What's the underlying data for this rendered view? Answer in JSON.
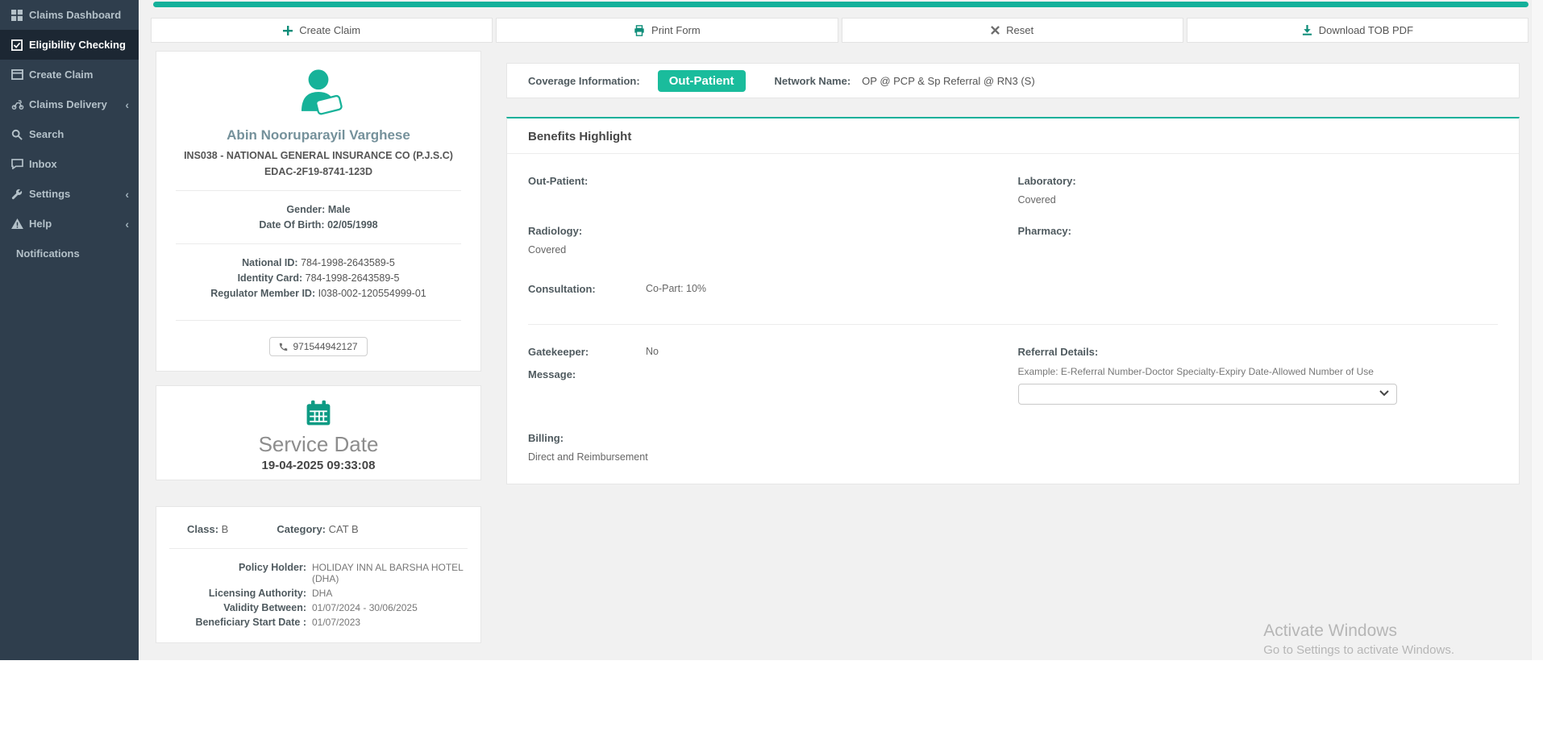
{
  "colors": {
    "accent_teal": "#14b09a",
    "badge_teal": "#1abc9c",
    "sidebar_bg": "#2f3e4d",
    "sidebar_active_bg": "#1c2733",
    "page_bg": "#f1f1f1"
  },
  "sidebar": {
    "items": [
      {
        "label": "Claims Dashboard",
        "icon": "grid-icon",
        "active": false,
        "chevron": false
      },
      {
        "label": "Eligibility Checking",
        "icon": "check-square-icon",
        "active": true,
        "chevron": false
      },
      {
        "label": "Create Claim",
        "icon": "card-icon",
        "active": false,
        "chevron": false
      },
      {
        "label": "Claims Delivery",
        "icon": "scooter-icon",
        "active": false,
        "chevron": true
      },
      {
        "label": "Search",
        "icon": "search-icon",
        "active": false,
        "chevron": false
      },
      {
        "label": "Inbox",
        "icon": "chat-icon",
        "active": false,
        "chevron": false
      },
      {
        "label": "Settings",
        "icon": "wrench-icon",
        "active": false,
        "chevron": true
      },
      {
        "label": "Help",
        "icon": "warning-icon",
        "active": false,
        "chevron": true
      },
      {
        "label": "Notifications",
        "icon": "",
        "active": false,
        "chevron": false
      }
    ],
    "chevron_glyph": "‹"
  },
  "toolbar": {
    "buttons": [
      {
        "label": "Create Claim",
        "icon": "plus-icon"
      },
      {
        "label": "Print Form",
        "icon": "printer-icon"
      },
      {
        "label": "Reset",
        "icon": "x-icon"
      },
      {
        "label": "Download TOB PDF",
        "icon": "download-icon"
      }
    ]
  },
  "patient": {
    "name": "Abin Nooruparayil Varghese",
    "insurer": "INS038 - NATIONAL GENERAL INSURANCE CO (P.J.S.C)",
    "card_number": "EDAC-2F19-8741-123D",
    "gender_label": "Gender:",
    "gender": "Male",
    "dob_label": "Date Of Birth:",
    "dob": "02/05/1998",
    "national_id_label": "National ID:",
    "national_id": "784-1998-2643589-5",
    "identity_card_label": "Identity Card:",
    "identity_card": "784-1998-2643589-5",
    "regulator_label": "Regulator Member ID:",
    "regulator_id": "I038-002-120554999-01",
    "phone": "971544942127"
  },
  "service": {
    "title": "Service Date",
    "datetime": "19-04-2025 09:33:08"
  },
  "policy": {
    "class_label": "Class:",
    "class_value": "B",
    "category_label": "Category:",
    "category_value": "CAT B",
    "holder_label": "Policy Holder:",
    "holder_value": "HOLIDAY INN AL BARSHA HOTEL (DHA)",
    "licensing_label": "Licensing Authority:",
    "licensing_value": "DHA",
    "validity_label": "Validity Between:",
    "validity_value": "01/07/2024 - 30/06/2025",
    "beneficiary_label": "Beneficiary Start Date :",
    "beneficiary_value": "01/07/2023"
  },
  "coverage": {
    "label": "Coverage Information:",
    "badge": "Out-Patient",
    "network_label": "Network Name:",
    "network_value": "OP @ PCP & Sp Referral @ RN3 (S)"
  },
  "benefits": {
    "title": "Benefits Highlight",
    "out_patient_label": "Out-Patient:",
    "out_patient_value": "",
    "laboratory_label": "Laboratory:",
    "laboratory_value": "Covered",
    "radiology_label": "Radiology:",
    "radiology_value": "Covered",
    "pharmacy_label": "Pharmacy:",
    "pharmacy_value": "",
    "consultation_label": "Consultation:",
    "consultation_value": "Co-Part: 10%",
    "gatekeeper_label": "Gatekeeper:",
    "gatekeeper_value": "No",
    "message_label": "Message:",
    "message_value": "",
    "referral_label": "Referral Details:",
    "referral_example": "Example: E-Referral Number-Doctor Specialty-Expiry Date-Allowed Number of Use",
    "referral_selected": "",
    "billing_label": "Billing:",
    "billing_value": "Direct and Reimbursement"
  },
  "watermark": {
    "line1": "Activate Windows",
    "line2": "Go to Settings to activate Windows."
  }
}
